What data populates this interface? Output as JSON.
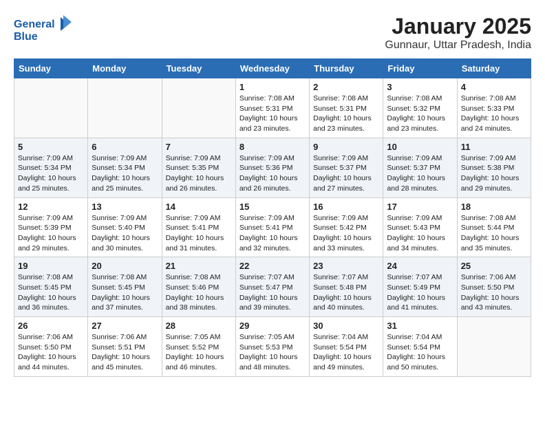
{
  "logo": {
    "general": "General",
    "blue": "Blue"
  },
  "title": "January 2025",
  "location": "Gunnaur, Uttar Pradesh, India",
  "weekdays": [
    "Sunday",
    "Monday",
    "Tuesday",
    "Wednesday",
    "Thursday",
    "Friday",
    "Saturday"
  ],
  "weeks": [
    [
      {
        "day": "",
        "info": ""
      },
      {
        "day": "",
        "info": ""
      },
      {
        "day": "",
        "info": ""
      },
      {
        "day": "1",
        "info": "Sunrise: 7:08 AM\nSunset: 5:31 PM\nDaylight: 10 hours\nand 23 minutes."
      },
      {
        "day": "2",
        "info": "Sunrise: 7:08 AM\nSunset: 5:31 PM\nDaylight: 10 hours\nand 23 minutes."
      },
      {
        "day": "3",
        "info": "Sunrise: 7:08 AM\nSunset: 5:32 PM\nDaylight: 10 hours\nand 23 minutes."
      },
      {
        "day": "4",
        "info": "Sunrise: 7:08 AM\nSunset: 5:33 PM\nDaylight: 10 hours\nand 24 minutes."
      }
    ],
    [
      {
        "day": "5",
        "info": "Sunrise: 7:09 AM\nSunset: 5:34 PM\nDaylight: 10 hours\nand 25 minutes."
      },
      {
        "day": "6",
        "info": "Sunrise: 7:09 AM\nSunset: 5:34 PM\nDaylight: 10 hours\nand 25 minutes."
      },
      {
        "day": "7",
        "info": "Sunrise: 7:09 AM\nSunset: 5:35 PM\nDaylight: 10 hours\nand 26 minutes."
      },
      {
        "day": "8",
        "info": "Sunrise: 7:09 AM\nSunset: 5:36 PM\nDaylight: 10 hours\nand 26 minutes."
      },
      {
        "day": "9",
        "info": "Sunrise: 7:09 AM\nSunset: 5:37 PM\nDaylight: 10 hours\nand 27 minutes."
      },
      {
        "day": "10",
        "info": "Sunrise: 7:09 AM\nSunset: 5:37 PM\nDaylight: 10 hours\nand 28 minutes."
      },
      {
        "day": "11",
        "info": "Sunrise: 7:09 AM\nSunset: 5:38 PM\nDaylight: 10 hours\nand 29 minutes."
      }
    ],
    [
      {
        "day": "12",
        "info": "Sunrise: 7:09 AM\nSunset: 5:39 PM\nDaylight: 10 hours\nand 29 minutes."
      },
      {
        "day": "13",
        "info": "Sunrise: 7:09 AM\nSunset: 5:40 PM\nDaylight: 10 hours\nand 30 minutes."
      },
      {
        "day": "14",
        "info": "Sunrise: 7:09 AM\nSunset: 5:41 PM\nDaylight: 10 hours\nand 31 minutes."
      },
      {
        "day": "15",
        "info": "Sunrise: 7:09 AM\nSunset: 5:41 PM\nDaylight: 10 hours\nand 32 minutes."
      },
      {
        "day": "16",
        "info": "Sunrise: 7:09 AM\nSunset: 5:42 PM\nDaylight: 10 hours\nand 33 minutes."
      },
      {
        "day": "17",
        "info": "Sunrise: 7:09 AM\nSunset: 5:43 PM\nDaylight: 10 hours\nand 34 minutes."
      },
      {
        "day": "18",
        "info": "Sunrise: 7:08 AM\nSunset: 5:44 PM\nDaylight: 10 hours\nand 35 minutes."
      }
    ],
    [
      {
        "day": "19",
        "info": "Sunrise: 7:08 AM\nSunset: 5:45 PM\nDaylight: 10 hours\nand 36 minutes."
      },
      {
        "day": "20",
        "info": "Sunrise: 7:08 AM\nSunset: 5:45 PM\nDaylight: 10 hours\nand 37 minutes."
      },
      {
        "day": "21",
        "info": "Sunrise: 7:08 AM\nSunset: 5:46 PM\nDaylight: 10 hours\nand 38 minutes."
      },
      {
        "day": "22",
        "info": "Sunrise: 7:07 AM\nSunset: 5:47 PM\nDaylight: 10 hours\nand 39 minutes."
      },
      {
        "day": "23",
        "info": "Sunrise: 7:07 AM\nSunset: 5:48 PM\nDaylight: 10 hours\nand 40 minutes."
      },
      {
        "day": "24",
        "info": "Sunrise: 7:07 AM\nSunset: 5:49 PM\nDaylight: 10 hours\nand 41 minutes."
      },
      {
        "day": "25",
        "info": "Sunrise: 7:06 AM\nSunset: 5:50 PM\nDaylight: 10 hours\nand 43 minutes."
      }
    ],
    [
      {
        "day": "26",
        "info": "Sunrise: 7:06 AM\nSunset: 5:50 PM\nDaylight: 10 hours\nand 44 minutes."
      },
      {
        "day": "27",
        "info": "Sunrise: 7:06 AM\nSunset: 5:51 PM\nDaylight: 10 hours\nand 45 minutes."
      },
      {
        "day": "28",
        "info": "Sunrise: 7:05 AM\nSunset: 5:52 PM\nDaylight: 10 hours\nand 46 minutes."
      },
      {
        "day": "29",
        "info": "Sunrise: 7:05 AM\nSunset: 5:53 PM\nDaylight: 10 hours\nand 48 minutes."
      },
      {
        "day": "30",
        "info": "Sunrise: 7:04 AM\nSunset: 5:54 PM\nDaylight: 10 hours\nand 49 minutes."
      },
      {
        "day": "31",
        "info": "Sunrise: 7:04 AM\nSunset: 5:54 PM\nDaylight: 10 hours\nand 50 minutes."
      },
      {
        "day": "",
        "info": ""
      }
    ]
  ]
}
